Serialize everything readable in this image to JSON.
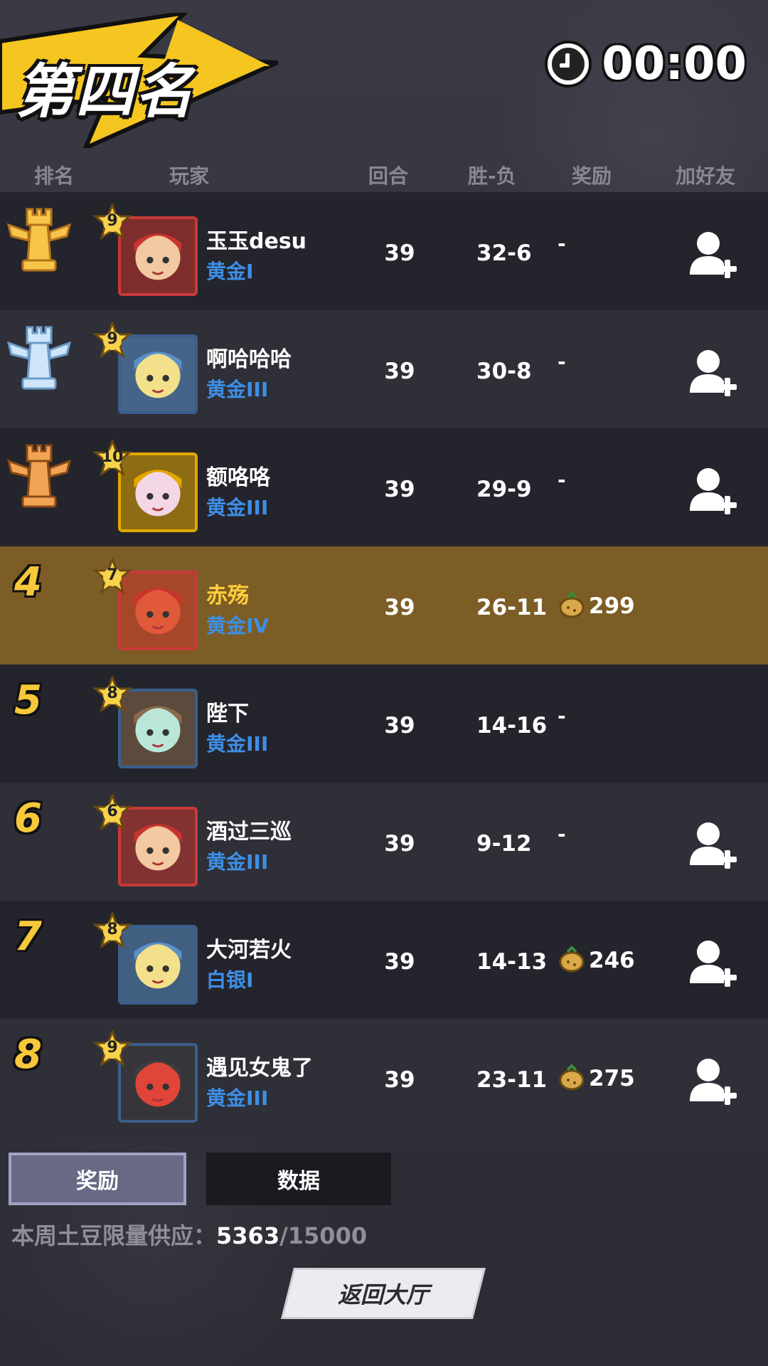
{
  "header": {
    "placement_title": "第四名",
    "timer": "00:00"
  },
  "columns": {
    "rank": "排名",
    "player": "玩家",
    "rounds": "回合",
    "win_loss": "胜-负",
    "reward": "奖励",
    "add_friend": "加好友"
  },
  "rows": [
    {
      "rank": "1",
      "medal": "gold",
      "level": "9",
      "name": "玉玉desu",
      "tier": "黄金I",
      "rounds": "39",
      "win_loss": "32-6",
      "reward": "-",
      "friend": true
    },
    {
      "rank": "2",
      "medal": "silver",
      "level": "9",
      "name": "啊哈哈哈",
      "tier": "黄金III",
      "rounds": "39",
      "win_loss": "30-8",
      "reward": "-",
      "friend": true
    },
    {
      "rank": "3",
      "medal": "bronze",
      "level": "10",
      "name": "额咯咯",
      "tier": "黄金III",
      "rounds": "39",
      "win_loss": "29-9",
      "reward": "-",
      "friend": true
    },
    {
      "rank": "4",
      "medal": "",
      "level": "7",
      "name": "赤殇",
      "tier": "黄金IV",
      "rounds": "39",
      "win_loss": "26-11",
      "reward": "299",
      "friend": false
    },
    {
      "rank": "5",
      "medal": "",
      "level": "8",
      "name": "陛下",
      "tier": "黄金III",
      "rounds": "39",
      "win_loss": "14-16",
      "reward": "-",
      "friend": false
    },
    {
      "rank": "6",
      "medal": "",
      "level": "6",
      "name": "酒过三巡",
      "tier": "黄金III",
      "rounds": "39",
      "win_loss": "9-12",
      "reward": "-",
      "friend": true
    },
    {
      "rank": "7",
      "medal": "",
      "level": "8",
      "name": "大河若火",
      "tier": "白银I",
      "rounds": "39",
      "win_loss": "14-13",
      "reward": "246",
      "friend": true
    },
    {
      "rank": "8",
      "medal": "",
      "level": "9",
      "name": "遇见女鬼了",
      "tier": "黄金III",
      "rounds": "39",
      "win_loss": "23-11",
      "reward": "275",
      "friend": true
    }
  ],
  "tabs": {
    "reward": "奖励",
    "stats": "数据"
  },
  "quota": {
    "label": "本周土豆限量供应：",
    "current": "5363",
    "total": "/15000"
  },
  "back_button": "返回大厅",
  "colors": {
    "highlight_row": "#7c5d26",
    "tier_text": "#3d8fe6",
    "rank_number": "#f6c83a"
  }
}
